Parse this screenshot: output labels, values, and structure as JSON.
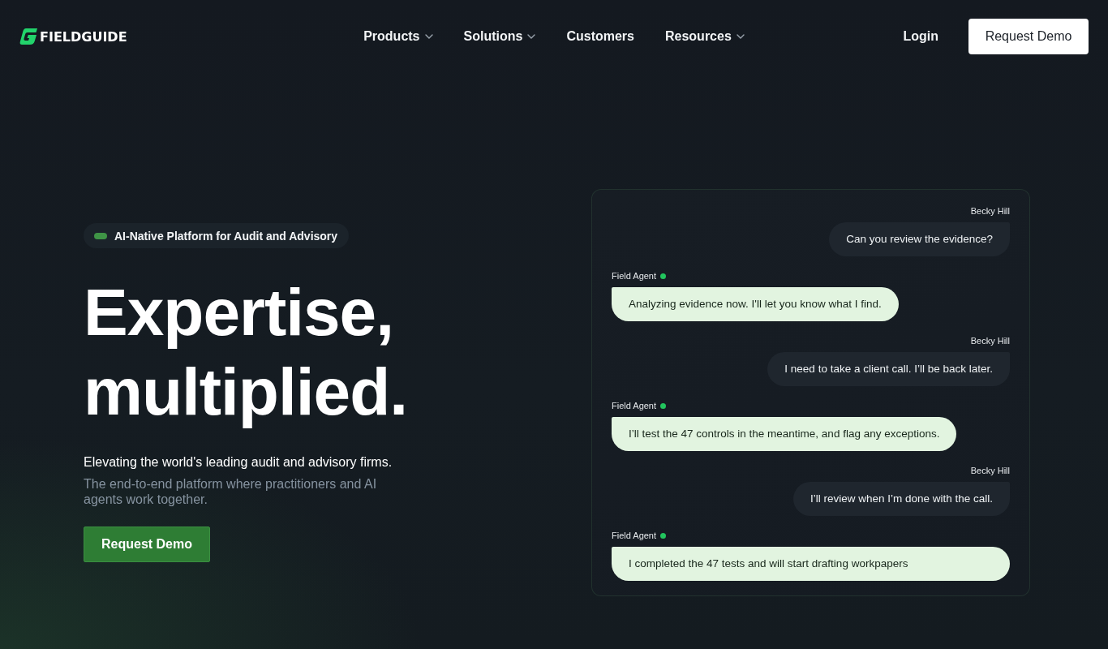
{
  "header": {
    "logo": "FIELDGUIDE",
    "nav": [
      {
        "label": "Products",
        "has_menu": true
      },
      {
        "label": "Solutions",
        "has_menu": true
      },
      {
        "label": "Customers",
        "has_menu": false
      },
      {
        "label": "Resources",
        "has_menu": true
      }
    ],
    "login": "Login",
    "cta": "Request Demo"
  },
  "hero": {
    "badge": "AI-Native Platform for Audit and Advisory",
    "headline": "Expertise, multiplied.",
    "tagline": "Elevating the world's leading audit and advisory firms.",
    "description": "The end-to-end platform where practitioners and AI agents work together.",
    "cta": "Request Demo"
  },
  "chat": {
    "messages": [
      {
        "kind": "user",
        "sender": "Becky Hill",
        "text": "Can you review the evidence?"
      },
      {
        "kind": "agent",
        "sender": "Field Agent",
        "text": "Analyzing evidence now. I'll let you know what I find."
      },
      {
        "kind": "user",
        "sender": "Becky Hill",
        "text": "I need to take a client call. I’ll be back later."
      },
      {
        "kind": "agent",
        "sender": "Field Agent",
        "text": "I’ll test the 47 controls in the meantime, and flag any exceptions."
      },
      {
        "kind": "user",
        "sender": "Becky Hill",
        "text": "I’ll review when I’m done with the call."
      },
      {
        "kind": "agent",
        "sender": "Field Agent",
        "text": "I completed the 47 tests and will start drafting workpapers"
      }
    ]
  }
}
